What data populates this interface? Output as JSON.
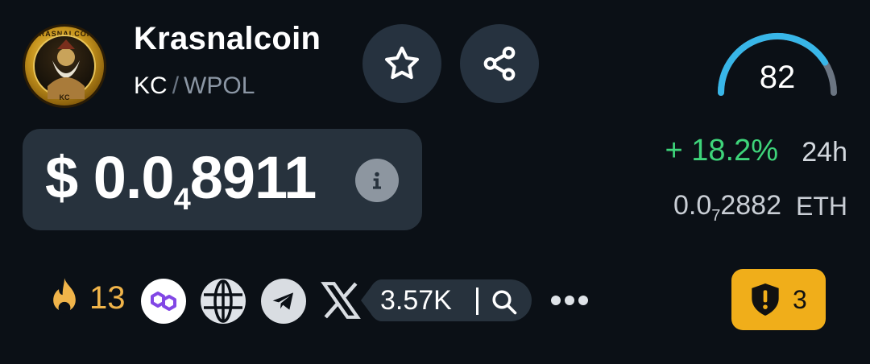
{
  "token": {
    "logo_ring_text": "KRASNALCOIN",
    "logo_bottom_text": "KC",
    "name": "Krasnalcoin",
    "symbol": "KC",
    "pair_separator": "/",
    "quote_symbol": "WPOL"
  },
  "actions": {
    "favorite_icon": "star-icon",
    "share_icon": "share-icon"
  },
  "score": {
    "value": "82",
    "fill_fraction": 0.82,
    "color": "#38b6e8"
  },
  "price": {
    "prefix": "$ 0.0",
    "zero_count": "4",
    "digits": "8911",
    "info_icon": "info-icon"
  },
  "change": {
    "value": "+ 18.2%",
    "period": "24h",
    "color": "#3ed47a"
  },
  "eth_price": {
    "prefix": "0.0",
    "zero_count": "7",
    "digits": "2882",
    "unit": "ETH"
  },
  "social": {
    "hot_count": "13",
    "followers": "3.57K",
    "icons": [
      "flame-icon",
      "polygon-icon",
      "globe-icon",
      "telegram-icon",
      "x-icon",
      "search-icon",
      "more-icon"
    ]
  },
  "alerts": {
    "count": "3",
    "color": "#f0ae1a",
    "icon": "shield-alert-icon"
  }
}
